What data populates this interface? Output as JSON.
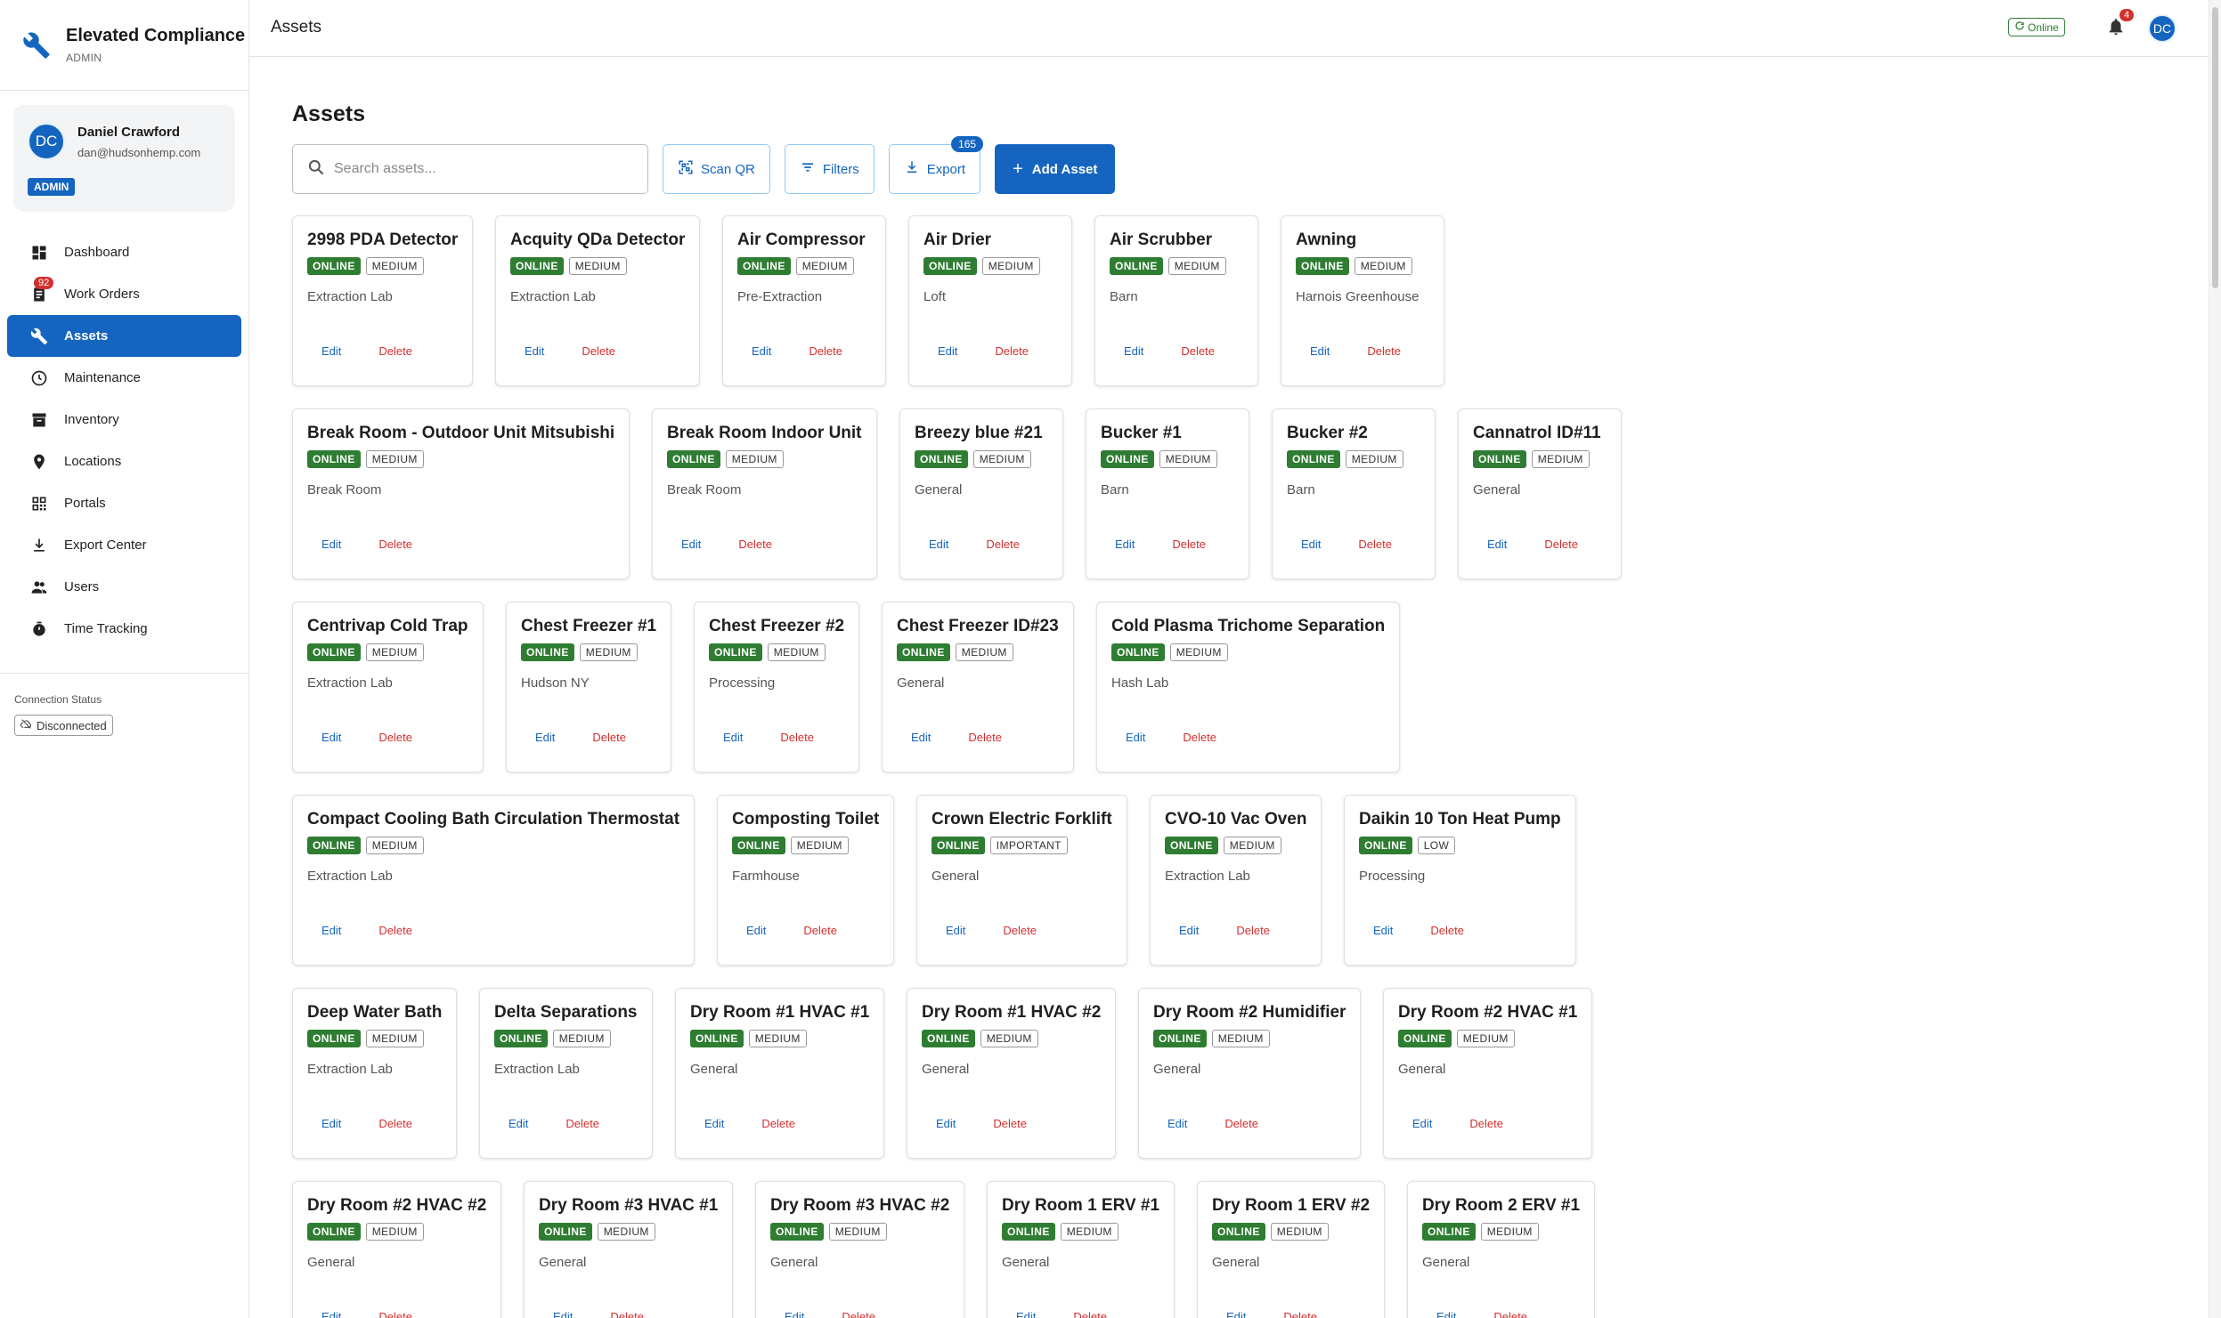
{
  "brand": {
    "title": "Elevated Compliance",
    "subtitle": "ADMIN",
    "icon": "wrench-icon"
  },
  "user": {
    "initials": "DC",
    "name": "Daniel Crawford",
    "email": "dan@hudsonhemp.com",
    "role": "ADMIN"
  },
  "nav": [
    {
      "label": "Dashboard",
      "icon": "dashboard-icon",
      "active": false
    },
    {
      "label": "Work Orders",
      "icon": "work-orders-icon",
      "active": false,
      "badge": "92"
    },
    {
      "label": "Assets",
      "icon": "wrench-icon",
      "active": true
    },
    {
      "label": "Maintenance",
      "icon": "clock-icon",
      "active": false
    },
    {
      "label": "Inventory",
      "icon": "inventory-icon",
      "active": false
    },
    {
      "label": "Locations",
      "icon": "location-pin-icon",
      "active": false
    },
    {
      "label": "Portals",
      "icon": "qr-icon",
      "active": false
    },
    {
      "label": "Export Center",
      "icon": "download-icon",
      "active": false
    },
    {
      "label": "Users",
      "icon": "users-icon",
      "active": false
    },
    {
      "label": "Time Tracking",
      "icon": "stopwatch-icon",
      "active": false
    }
  ],
  "connection": {
    "label": "Connection Status",
    "status": "Disconnected"
  },
  "topbar": {
    "title": "Assets",
    "online": "Online",
    "notifications": "4",
    "initials": "DC"
  },
  "page": {
    "title": "Assets",
    "search_placeholder": "Search assets...",
    "scan_qr": "Scan QR",
    "filters": "Filters",
    "export": "Export",
    "export_count": "165",
    "add_asset": "Add Asset"
  },
  "card_actions": {
    "edit": "Edit",
    "delete": "Delete"
  },
  "colors": {
    "primary": "#1565c0",
    "online": "#2e7d32",
    "danger": "#d32f2f"
  },
  "assets": [
    {
      "name": "2998 PDA Detector",
      "status": "ONLINE",
      "priority": "MEDIUM",
      "location": "Extraction Lab"
    },
    {
      "name": "Acquity QDa Detector",
      "status": "ONLINE",
      "priority": "MEDIUM",
      "location": "Extraction Lab"
    },
    {
      "name": "Air Compressor",
      "status": "ONLINE",
      "priority": "MEDIUM",
      "location": "Pre-Extraction"
    },
    {
      "name": "Air Drier",
      "status": "ONLINE",
      "priority": "MEDIUM",
      "location": "Loft"
    },
    {
      "name": "Air Scrubber",
      "status": "ONLINE",
      "priority": "MEDIUM",
      "location": "Barn"
    },
    {
      "name": "Awning",
      "status": "ONLINE",
      "priority": "MEDIUM",
      "location": "Harnois Greenhouse"
    },
    {
      "name": "Break Room - Outdoor Unit Mitsubishi",
      "status": "ONLINE",
      "priority": "MEDIUM",
      "location": "Break Room"
    },
    {
      "name": "Break Room Indoor Unit",
      "status": "ONLINE",
      "priority": "MEDIUM",
      "location": "Break Room"
    },
    {
      "name": "Breezy blue #21",
      "status": "ONLINE",
      "priority": "MEDIUM",
      "location": "General"
    },
    {
      "name": "Bucker #1",
      "status": "ONLINE",
      "priority": "MEDIUM",
      "location": "Barn"
    },
    {
      "name": "Bucker #2",
      "status": "ONLINE",
      "priority": "MEDIUM",
      "location": "Barn"
    },
    {
      "name": "Cannatrol ID#11",
      "status": "ONLINE",
      "priority": "MEDIUM",
      "location": "General"
    },
    {
      "name": "Centrivap Cold Trap",
      "status": "ONLINE",
      "priority": "MEDIUM",
      "location": "Extraction Lab"
    },
    {
      "name": "Chest Freezer #1",
      "status": "ONLINE",
      "priority": "MEDIUM",
      "location": "Hudson NY"
    },
    {
      "name": "Chest Freezer #2",
      "status": "ONLINE",
      "priority": "MEDIUM",
      "location": "Processing"
    },
    {
      "name": "Chest Freezer ID#23",
      "status": "ONLINE",
      "priority": "MEDIUM",
      "location": "General"
    },
    {
      "name": "Cold Plasma Trichome Separation",
      "status": "ONLINE",
      "priority": "MEDIUM",
      "location": "Hash Lab"
    },
    {
      "name": "Compact Cooling Bath Circulation Thermostat",
      "status": "ONLINE",
      "priority": "MEDIUM",
      "location": "Extraction Lab"
    },
    {
      "name": "Composting Toilet",
      "status": "ONLINE",
      "priority": "MEDIUM",
      "location": "Farmhouse"
    },
    {
      "name": "Crown Electric Forklift",
      "status": "ONLINE",
      "priority": "IMPORTANT",
      "location": "General"
    },
    {
      "name": "CVO-10 Vac Oven",
      "status": "ONLINE",
      "priority": "MEDIUM",
      "location": "Extraction Lab"
    },
    {
      "name": "Daikin 10 Ton Heat Pump",
      "status": "ONLINE",
      "priority": "LOW",
      "location": "Processing"
    },
    {
      "name": "Deep Water Bath",
      "status": "ONLINE",
      "priority": "MEDIUM",
      "location": "Extraction Lab"
    },
    {
      "name": "Delta Separations",
      "status": "ONLINE",
      "priority": "MEDIUM",
      "location": "Extraction Lab"
    },
    {
      "name": "Dry Room #1 HVAC #1",
      "status": "ONLINE",
      "priority": "MEDIUM",
      "location": "General"
    },
    {
      "name": "Dry Room #1 HVAC #2",
      "status": "ONLINE",
      "priority": "MEDIUM",
      "location": "General"
    },
    {
      "name": "Dry Room #2 Humidifier",
      "status": "ONLINE",
      "priority": "MEDIUM",
      "location": "General"
    },
    {
      "name": "Dry Room #2 HVAC #1",
      "status": "ONLINE",
      "priority": "MEDIUM",
      "location": "General"
    },
    {
      "name": "Dry Room #2 HVAC #2",
      "status": "ONLINE",
      "priority": "MEDIUM",
      "location": "General"
    },
    {
      "name": "Dry Room #3 HVAC #1",
      "status": "ONLINE",
      "priority": "MEDIUM",
      "location": "General"
    },
    {
      "name": "Dry Room #3 HVAC #2",
      "status": "ONLINE",
      "priority": "MEDIUM",
      "location": "General"
    },
    {
      "name": "Dry Room 1 ERV #1",
      "status": "ONLINE",
      "priority": "MEDIUM",
      "location": "General"
    },
    {
      "name": "Dry Room 1 ERV #2",
      "status": "ONLINE",
      "priority": "MEDIUM",
      "location": "General"
    },
    {
      "name": "Dry Room 2 ERV #1",
      "status": "ONLINE",
      "priority": "MEDIUM",
      "location": "General"
    }
  ]
}
